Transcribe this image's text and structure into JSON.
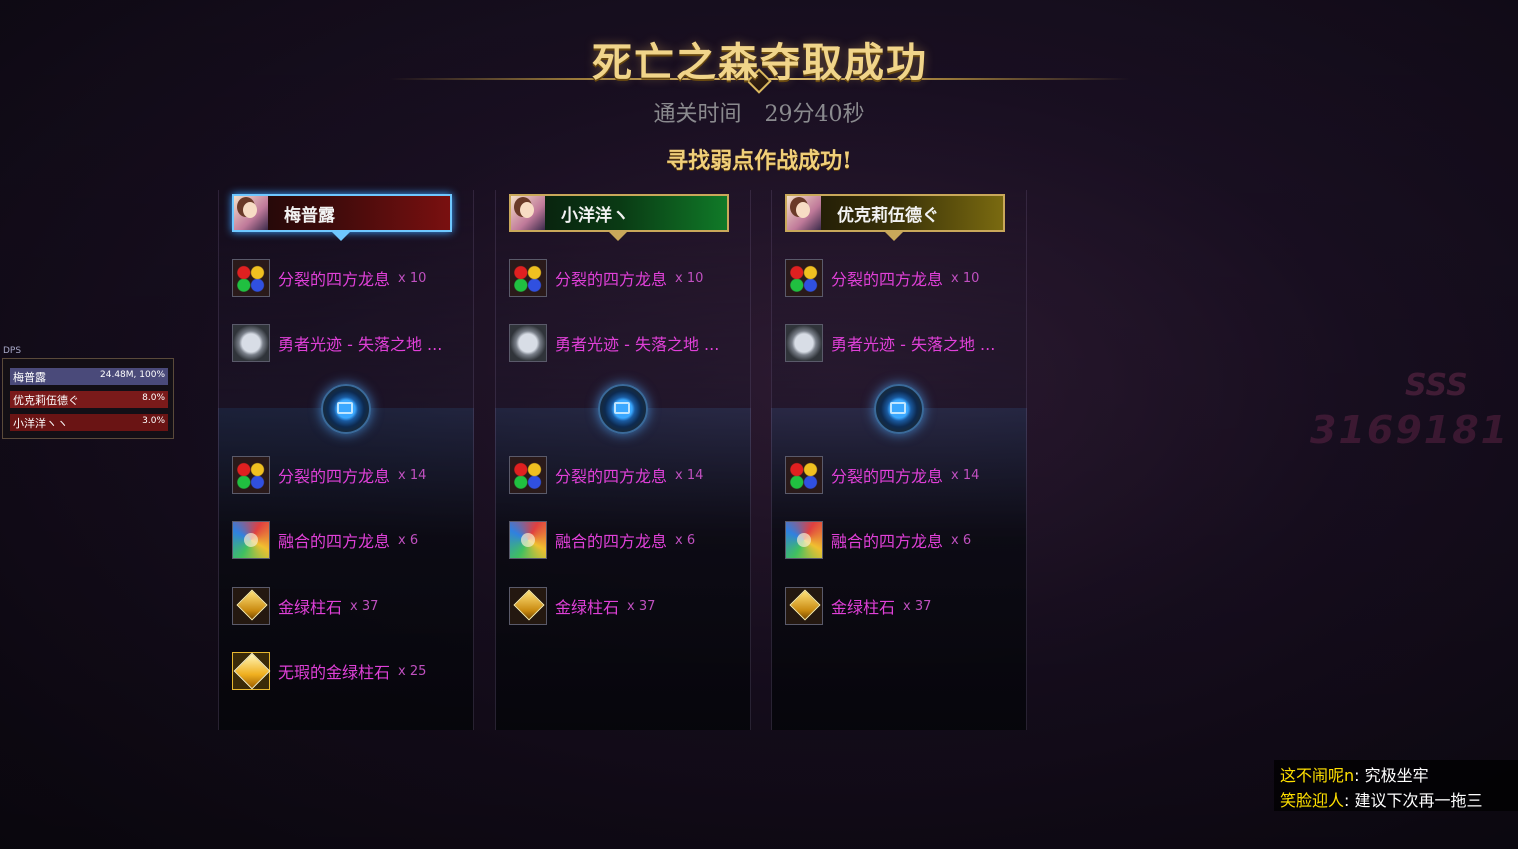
{
  "title": "死亡之森夺取成功",
  "clear_time": {
    "label": "通关时间",
    "value": "29分40秒"
  },
  "subtitle": "寻找弱点作战成功!",
  "players": [
    {
      "name": "梅普露",
      "plate_style": "red",
      "is_self": true,
      "rewards_top": [
        {
          "icon": "dragon-breath-split-icon",
          "name": "分裂的四方龙息",
          "qty": "x 10"
        },
        {
          "icon": "hero-trace-icon",
          "name": "勇者光迹 - 失落之地 ...",
          "qty": ""
        }
      ],
      "rewards_bottom": [
        {
          "icon": "dragon-breath-split-icon",
          "name": "分裂的四方龙息",
          "qty": "x 14"
        },
        {
          "icon": "dragon-breath-fused-icon",
          "name": "融合的四方龙息",
          "qty": "x 6"
        },
        {
          "icon": "gold-green-stone-icon",
          "name": "金绿柱石",
          "qty": "x 37"
        },
        {
          "icon": "flawless-gold-green-stone-icon",
          "name": "无瑕的金绿柱石",
          "qty": "x 25"
        }
      ]
    },
    {
      "name": "小洋洋ヽ",
      "plate_style": "green",
      "is_self": false,
      "rewards_top": [
        {
          "icon": "dragon-breath-split-icon",
          "name": "分裂的四方龙息",
          "qty": "x 10"
        },
        {
          "icon": "hero-trace-icon",
          "name": "勇者光迹 - 失落之地 ...",
          "qty": ""
        }
      ],
      "rewards_bottom": [
        {
          "icon": "dragon-breath-split-icon",
          "name": "分裂的四方龙息",
          "qty": "x 14"
        },
        {
          "icon": "dragon-breath-fused-icon",
          "name": "融合的四方龙息",
          "qty": "x 6"
        },
        {
          "icon": "gold-green-stone-icon",
          "name": "金绿柱石",
          "qty": "x 37"
        }
      ]
    },
    {
      "name": "优克莉伍德ぐ",
      "plate_style": "gold",
      "is_self": false,
      "rewards_top": [
        {
          "icon": "dragon-breath-split-icon",
          "name": "分裂的四方龙息",
          "qty": "x 10"
        },
        {
          "icon": "hero-trace-icon",
          "name": "勇者光迹 - 失落之地 ...",
          "qty": ""
        }
      ],
      "rewards_bottom": [
        {
          "icon": "dragon-breath-split-icon",
          "name": "分裂的四方龙息",
          "qty": "x 14"
        },
        {
          "icon": "dragon-breath-fused-icon",
          "name": "融合的四方龙息",
          "qty": "x 6"
        },
        {
          "icon": "gold-green-stone-icon",
          "name": "金绿柱石",
          "qty": "x 37"
        }
      ]
    }
  ],
  "dps_panel": {
    "label": "DPS",
    "rows": [
      {
        "name": "梅普露",
        "value": "24.48M, 100%",
        "fill": 1.0,
        "color": "#4a4a7a"
      },
      {
        "name": "优克莉伍德ぐ",
        "value": "8.0%",
        "fill": 1.0,
        "color": "#7a1a1a"
      },
      {
        "name": "小洋洋ヽヽ",
        "value": "3.0%",
        "fill": 1.0,
        "color": "#6a1414"
      }
    ]
  },
  "score": {
    "rank": "SSS",
    "value": "3169181"
  },
  "chat": [
    {
      "who": "这不闹呢n",
      "msg": ": 究极坐牢"
    },
    {
      "who": "笑脸迎人",
      "msg": ": 建议下次再一拖三"
    }
  ],
  "colors": {
    "title_gold": "#f1d58a",
    "item_magenta": "#e040d8",
    "chat_name": "#ffe000"
  }
}
